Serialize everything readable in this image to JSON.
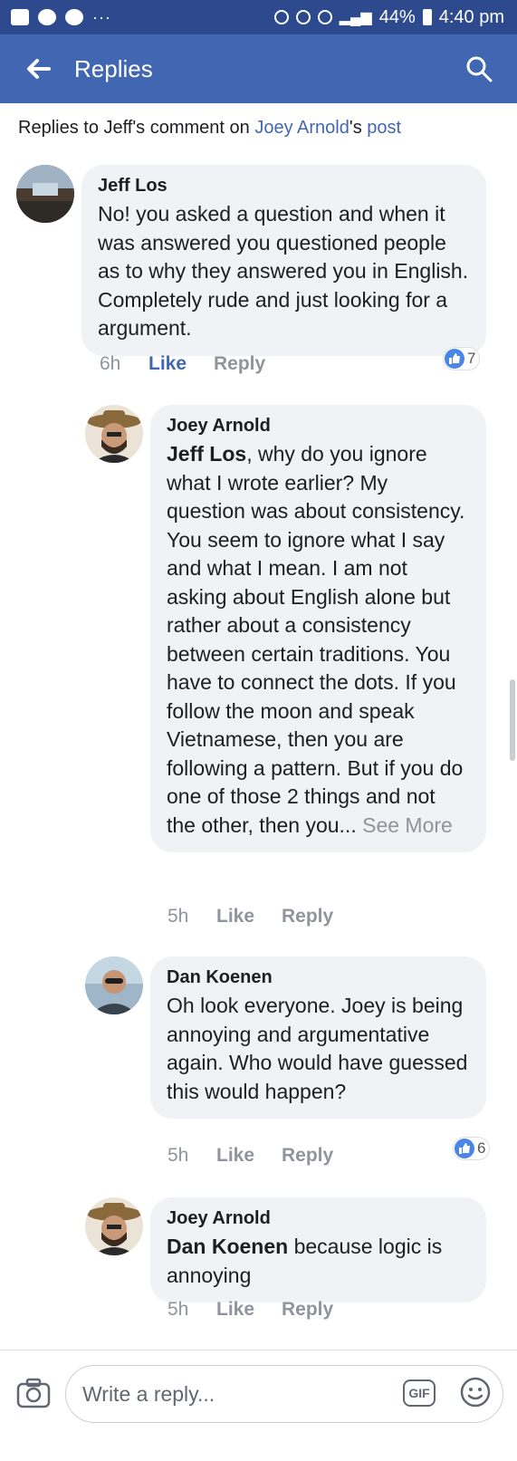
{
  "status_bar": {
    "battery": "44%",
    "time": "4:40 pm",
    "more": "···"
  },
  "app_bar": {
    "title": "Replies"
  },
  "context": {
    "prefix": "Replies to Jeff's comment on ",
    "author_link": "Joey Arnold",
    "possessive": "'s ",
    "post_link": "post"
  },
  "comments": [
    {
      "author": "Jeff Los",
      "mention": "",
      "text": "No! you asked a question and when it was answered you questioned people as to why  they answered you in English. Completely rude and just looking for a argument.",
      "time": "6h",
      "like_label": "Like",
      "reply_label": "Reply",
      "reactions": "7"
    },
    {
      "author": "Joey Arnold",
      "mention": "Jeff Los",
      "text": ", why do you ignore what I wrote earlier? My question was about consistency. You seem to ignore what I say and what I mean. I am not asking about English alone but rather about a consistency between certain traditions. You have to connect the dots. If you follow the moon and speak Vietnamese, then you are following a pattern. But if you do one of those 2 things and not the other, then you...",
      "see_more": " See More",
      "time": "5h",
      "like_label": "Like",
      "reply_label": "Reply"
    },
    {
      "author": "Dan Koenen",
      "mention": "",
      "text": "Oh look everyone. Joey is being annoying and argumentative again. Who would have guessed this would happen?",
      "time": "5h",
      "like_label": "Like",
      "reply_label": "Reply",
      "reactions": "6"
    },
    {
      "author": "Joey Arnold",
      "mention": "Dan Koenen",
      "text": " because logic is annoying",
      "time": "5h",
      "like_label": "Like",
      "reply_label": "Reply"
    }
  ],
  "composer": {
    "placeholder": "Write a reply...",
    "gif_label": "GIF"
  },
  "colors": {
    "brand": "#4267b2",
    "status_bar": "#2d4a8f",
    "bubble": "#f0f2f5",
    "muted": "#90949c"
  },
  "icons": [
    "image-icon",
    "app-icon",
    "messenger-icon",
    "back-arrow-icon",
    "search-icon",
    "thumbs-up-icon",
    "camera-icon",
    "emoji-icon"
  ]
}
